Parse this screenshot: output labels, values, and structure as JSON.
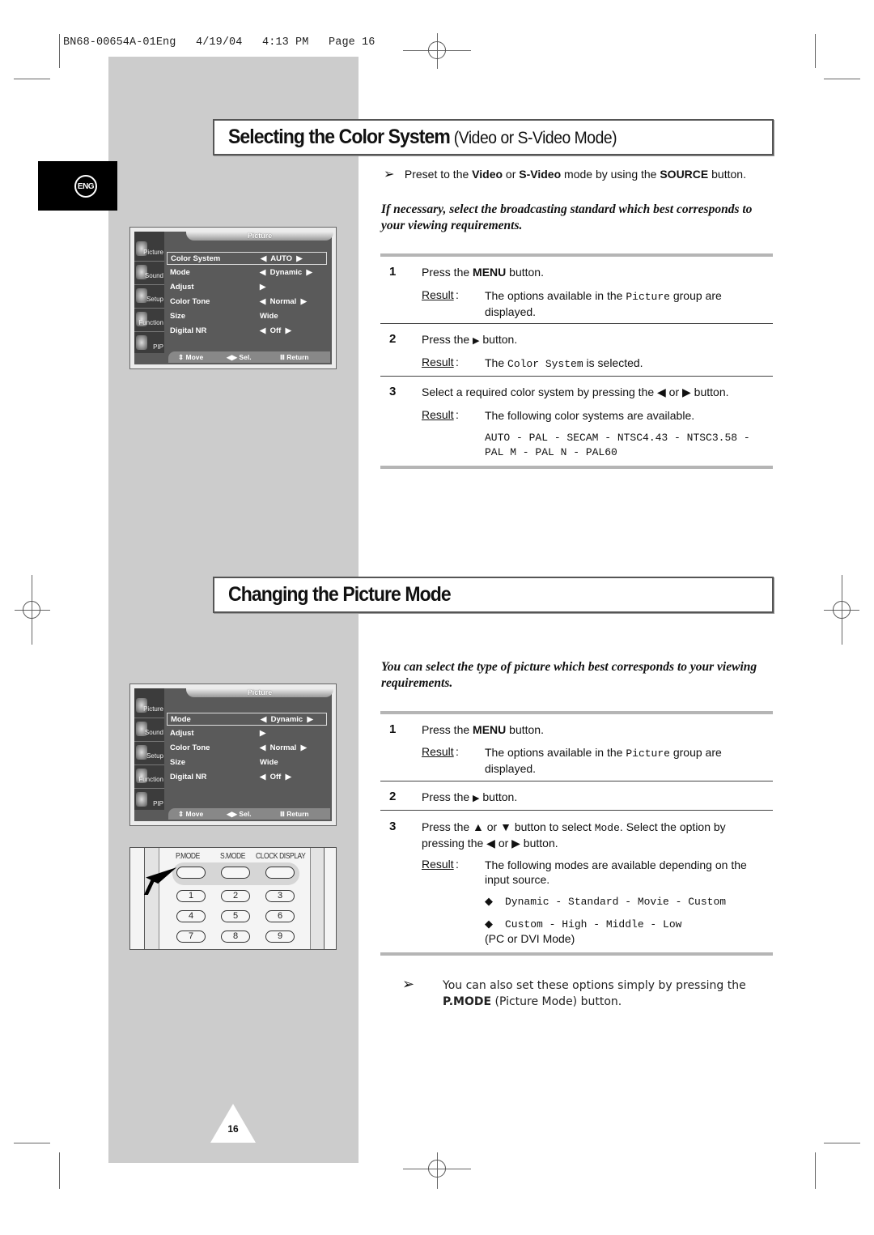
{
  "slug": "BN68-00654A-01Eng   4/19/04   4:13 PM   Page 16",
  "language_tab": "ENG",
  "page_number": "16",
  "section1": {
    "title_bold": "Selecting the Color System",
    "title_light": " (Video or S-Video Mode)",
    "note": {
      "arrow": "➢",
      "p1": "Preset to the ",
      "b1": "Video",
      "p2": " or ",
      "b2": "S-Video",
      "p3": " mode by using the ",
      "b3": "SOURCE",
      "p4": " button."
    },
    "intro": "If necessary, select the broadcasting standard which best corresponds to your viewing requirements.",
    "steps": [
      {
        "num": "1",
        "text_pre": "Press the ",
        "text_bold": "MENU",
        "text_post": " button.",
        "result_label": "Result",
        "result_pre": "The options available in the ",
        "result_code": "Picture",
        "result_post": " group are displayed."
      },
      {
        "num": "2",
        "text_pre": "Press the ",
        "text_icon": "▶",
        "text_post": " button.",
        "result_label": "Result",
        "result_pre": "The ",
        "result_code": "Color System",
        "result_post": " is selected."
      },
      {
        "num": "3",
        "text": "Select a required color system by pressing the ◀ or ▶ button.",
        "result_label": "Result",
        "result_text": "The following color systems are available.",
        "codes_line1": "AUTO - PAL - SECAM - NTSC4.43 - NTSC3.58 -",
        "codes_line2": "PAL M - PAL N - PAL60"
      }
    ],
    "osd": {
      "title": "Picture",
      "sidebar": [
        "Picture",
        "Sound",
        "Setup",
        "Function",
        "PIP"
      ],
      "rows": [
        {
          "label": "Color System",
          "value": "◀  AUTO  ▶",
          "selected": true
        },
        {
          "label": "Mode",
          "value": "◀  Dynamic  ▶"
        },
        {
          "label": "Adjust",
          "value": "▶"
        },
        {
          "label": "Color Tone",
          "value": "◀  Normal  ▶"
        },
        {
          "label": "Size",
          "value": "Wide"
        },
        {
          "label": "Digital NR",
          "value": "◀  Off  ▶"
        }
      ],
      "footer": {
        "move": "⇕ Move",
        "sel": "◀▶ Sel.",
        "ret": "Ⅲ Return"
      }
    }
  },
  "section2": {
    "title_bold": "Changing the Picture Mode",
    "intro": "You can select the type of picture which best corresponds to your viewing requirements.",
    "steps": [
      {
        "num": "1",
        "text_pre": "Press the ",
        "text_bold": "MENU",
        "text_post": " button.",
        "result_label": "Result",
        "result_pre": "The options available in the ",
        "result_code": "Picture",
        "result_post": " group are displayed."
      },
      {
        "num": "2",
        "text_pre": "Press the ",
        "text_icon": "▶",
        "text_post": " button."
      },
      {
        "num": "3",
        "text_pre": "Press the ▲ or ▼ button to select ",
        "text_code": "Mode",
        "text_post": ". Select the option by pressing the ◀ or ▶ button.",
        "result_label": "Result",
        "result_text": "The following modes are available depending on the input source.",
        "bullets": [
          {
            "icon": "◆",
            "text": "Dynamic - Standard - Movie - Custom"
          },
          {
            "icon": "◆",
            "text": "Custom - High - Middle - Low",
            "tail": "(PC or DVI Mode)"
          }
        ]
      }
    ],
    "osd": {
      "title": "Picture",
      "sidebar": [
        "Picture",
        "Sound",
        "Setup",
        "Function",
        "PIP"
      ],
      "rows": [
        {
          "label": "Mode",
          "value": "◀  Dynamic  ▶",
          "selected": true
        },
        {
          "label": "Adjust",
          "value": "▶"
        },
        {
          "label": "Color Tone",
          "value": "◀  Normal  ▶"
        },
        {
          "label": "Size",
          "value": "Wide"
        },
        {
          "label": "Digital NR",
          "value": "◀  Off  ▶"
        }
      ],
      "footer": {
        "move": "⇕ Move",
        "sel": "◀▶ Sel.",
        "ret": "Ⅲ Return"
      }
    },
    "remote": {
      "labels": [
        "P.MODE",
        "S.MODE",
        "CLOCK DISPLAY"
      ],
      "keys": [
        "1",
        "2",
        "3",
        "4",
        "5",
        "6",
        "7",
        "8",
        "9"
      ]
    },
    "tip": {
      "arrow": "➢",
      "text": "You can also set these options simply by pressing the ",
      "bold": "P.MODE",
      "tail": " (Picture Mode) button."
    }
  }
}
